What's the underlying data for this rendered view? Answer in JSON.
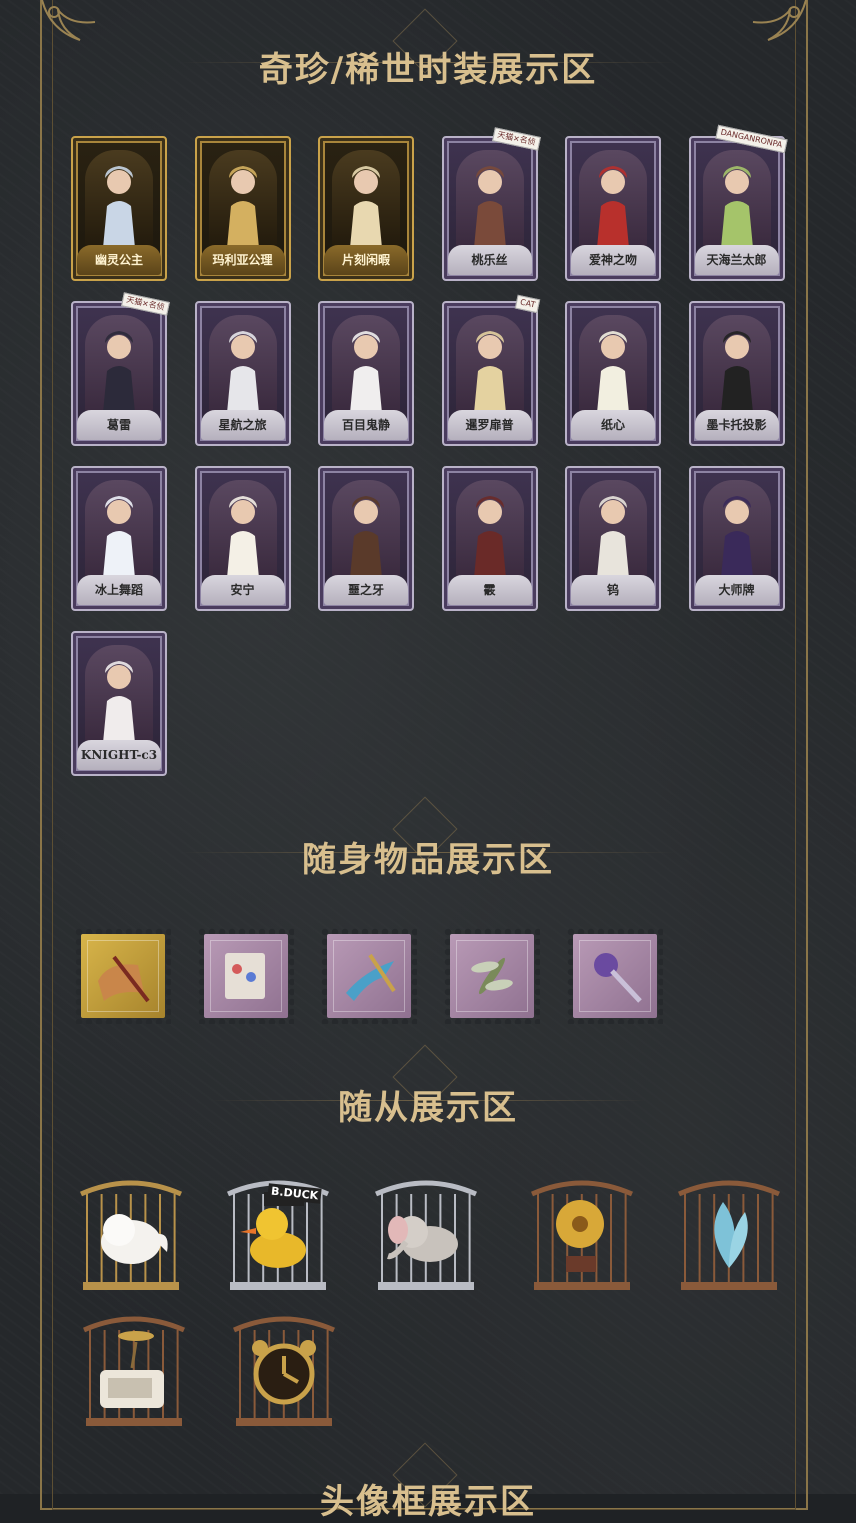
{
  "sections": {
    "outfits_title": "奇珍/稀世时装展示区",
    "items_title": "随身物品展示区",
    "pets_title": "随从展示区",
    "avatar_title": "头像框展示区"
  },
  "outfits": [
    {
      "label": "幽灵公主",
      "frame": "gold"
    },
    {
      "label": "玛利亚公理",
      "frame": "gold"
    },
    {
      "label": "片刻闲暇",
      "frame": "gold"
    },
    {
      "label": "桃乐丝",
      "frame": "purple"
    },
    {
      "label": "爱神之吻",
      "frame": "purple"
    },
    {
      "label": "天海兰太郎",
      "frame": "purple"
    },
    {
      "label": "葛雷",
      "frame": "purple"
    },
    {
      "label": "星航之旅",
      "frame": "purple"
    },
    {
      "label": "百目鬼静",
      "frame": "purple"
    },
    {
      "label": "暹罗扉普",
      "frame": "purple"
    },
    {
      "label": "纸心",
      "frame": "purple"
    },
    {
      "label": "墨卡托投影",
      "frame": "purple"
    },
    {
      "label": "冰上舞蹈",
      "frame": "purple"
    },
    {
      "label": "安宁",
      "frame": "purple"
    },
    {
      "label": "噩之牙",
      "frame": "purple"
    },
    {
      "label": "霰",
      "frame": "purple"
    },
    {
      "label": "钨",
      "frame": "purple"
    },
    {
      "label": "大师牌",
      "frame": "purple"
    },
    {
      "label": "KNIGHT-c3",
      "frame": "purple"
    }
  ],
  "items": [
    {
      "icon": "scroll-icon",
      "frame": "gold"
    },
    {
      "icon": "book-icon",
      "frame": "purple"
    },
    {
      "icon": "anchor-blade-icon",
      "frame": "purple"
    },
    {
      "icon": "dragonfly-icon",
      "frame": "purple"
    },
    {
      "icon": "crystal-staff-icon",
      "frame": "purple"
    }
  ],
  "pets": [
    {
      "icon": "white-dog-icon",
      "cage": "gold"
    },
    {
      "icon": "yellow-duck-icon",
      "cage": "silver",
      "badge": "B.DUCK"
    },
    {
      "icon": "elephant-icon",
      "cage": "silver"
    },
    {
      "icon": "golden-flower-icon",
      "cage": "bronze"
    },
    {
      "icon": "blue-butterfly-icon",
      "cage": "bronze"
    },
    {
      "icon": "tv-propeller-icon",
      "cage": "bronze"
    },
    {
      "icon": "alarm-clock-icon",
      "cage": "bronze"
    }
  ],
  "tags": [
    "天猫×名侦",
    "DANGANRONPA",
    "CAT"
  ],
  "colors": {
    "background": "#25282b",
    "gold": "#c9a24a",
    "title": "#d8bf8e",
    "purple_frame": "#b9b2c8"
  }
}
